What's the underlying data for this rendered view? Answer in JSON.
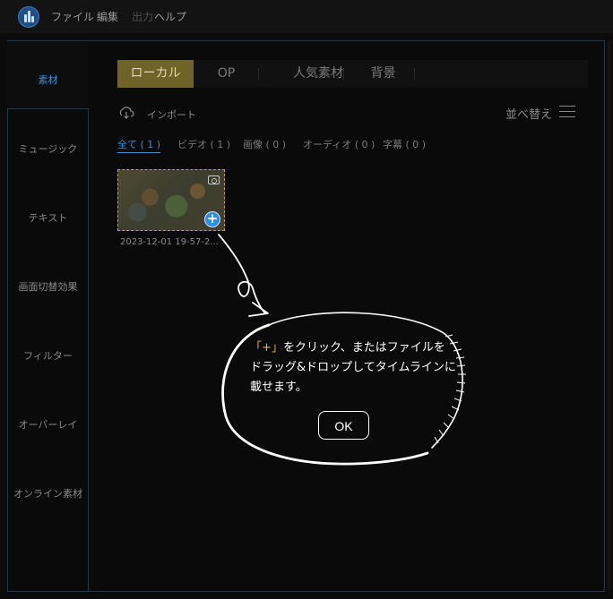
{
  "menubar": {
    "items": [
      "ファイル",
      "編集",
      "出力",
      "ヘルプ"
    ]
  },
  "sidebar": {
    "items": [
      "素材",
      "ミュージック",
      "テキスト",
      "画面切替効果",
      "フィルター",
      "オーバーレイ",
      "オンライン素材"
    ],
    "active": "素材"
  },
  "tabs": [
    "ローカル",
    "OP",
    "人気素材",
    "背景"
  ],
  "toolbar": {
    "import_label": "インポート",
    "sort_label": "並べ替え"
  },
  "filters": [
    "全て ( 1 )",
    "ビデオ ( 1 )",
    "画像 ( 0 )",
    "オーディオ ( 0 )",
    "字幕 ( 0 )"
  ],
  "media": {
    "caption": "2023-12-01 19-57-2...",
    "add_symbol": "+"
  },
  "tooltip": {
    "quote_open": "「",
    "quote_symbol": "+",
    "quote_close": "」",
    "line1_rest": "をクリック、またはファイルを",
    "line2": "ドラッグ&ドロップしてタイムラインに",
    "line3": "載せます。",
    "ok_label": "OK"
  },
  "colors": {
    "accent_blue": "#3d8fd1",
    "active_tab": "#6f6427",
    "highlight_yellow": "#e9b33b"
  }
}
